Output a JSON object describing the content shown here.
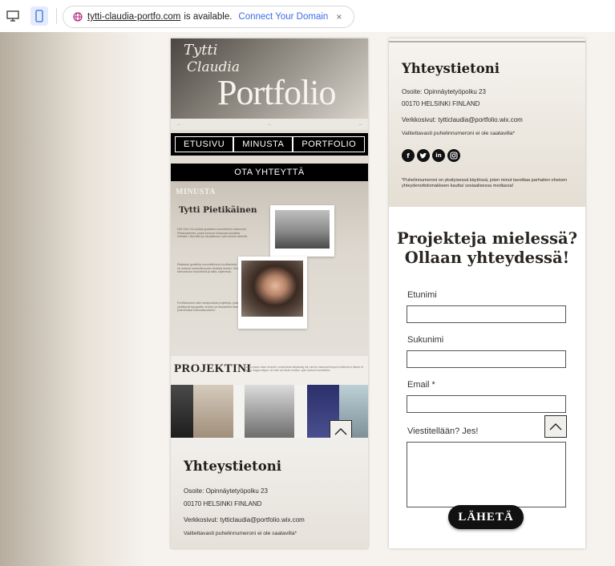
{
  "browser": {
    "url_domain": "tytti-claudia-portfo.com",
    "url_status": "is available.",
    "url_link": "Connect Your Domain",
    "close_glyph": "×"
  },
  "left_page": {
    "hero": {
      "script_line1": "Tytti",
      "script_line2": "Claudia",
      "title": "Portfolio"
    },
    "nav": {
      "home": "ETUSIVU",
      "about": "MINUSTA",
      "portfolio": "PORTFOLIO",
      "contact": "OTA YHTEYTTÄ"
    },
    "about": {
      "heading": "MINUSTA",
      "name": "Tytti Pietikäinen",
      "paragraph1": "Hei! Olen 23-vuotias graafinen suunnittelun tradenomi Pietarsaaresta, jonka luovuus kumpuaa kauniista hetkistä. Ulkonäkö ja visuaalisuus ovat minulle tärkeitä.",
      "paragraph2": "Rakastan graafista suunnittelua ja kuvittamista, koska ne antavat mahdollisuuden ilmaista itseäni. Olen kiinnostunut brändeistä ja taitto-ohjelmista.",
      "paragraph3": "Portfoliossani näet monipuolisia projekteja, joissa yhdistyvät typografia, kuvitus ja visuaalinen ilme yhteneväksi kokonaisuudeksi."
    },
    "projects": {
      "heading": "PROJEKTINI",
      "lorem": "Lorem ipsum dolor sit amet, consectetur adipiscing elit, sed do eiusmod tempor incididunt ut labore et dolore magna aliqua. Ut enim ad minim veniam, quis nostrud exercitation."
    },
    "contact": {
      "heading": "Yhteystietoni",
      "address_line1": "Osoite: Opinnäytetyöpolku 23",
      "address_line2": "00170 HELSINKI FINLAND",
      "website": "Verkkosivut: tytticlaudia@portfolio.wix.com",
      "phone_note": "Valitettavasti puhelinnumeroni ei ole saatavilla*"
    }
  },
  "right_page": {
    "contact": {
      "heading": "Yhteystietoni",
      "address_line1": "Osoite: Opinnäytetyöpolku 23",
      "address_line2": "00170 HELSINKI FINLAND",
      "website": "Verkkosivut: tytticlaudia@portfolio.wix.com",
      "phone_note": "Valitettavasti puhelinnumeroni ei ole saatavilla*",
      "socials": [
        "facebook-icon",
        "twitter-icon",
        "linkedin-icon",
        "instagram-icon"
      ],
      "footnote": "*Puhelinnumeroni on yksityisessä käytössä, joten minut tavoittaa parhaiten oheisen yhteydenottolomakkeen kautta/ sosiaalisessa mediassa!"
    },
    "form": {
      "heading_line1": "Projekteja mielessä?",
      "heading_line2": "Ollaan yhteydessä!",
      "first_name_label": "Etunimi",
      "last_name_label": "Sukunimi",
      "email_label": "Email *",
      "message_label": "Viestitellään? Jes!",
      "submit_label": "LÄHETÄ"
    }
  },
  "colors": {
    "accent_link": "#3b6be4",
    "dark": "#111111",
    "beige": "#e2ddd5"
  }
}
